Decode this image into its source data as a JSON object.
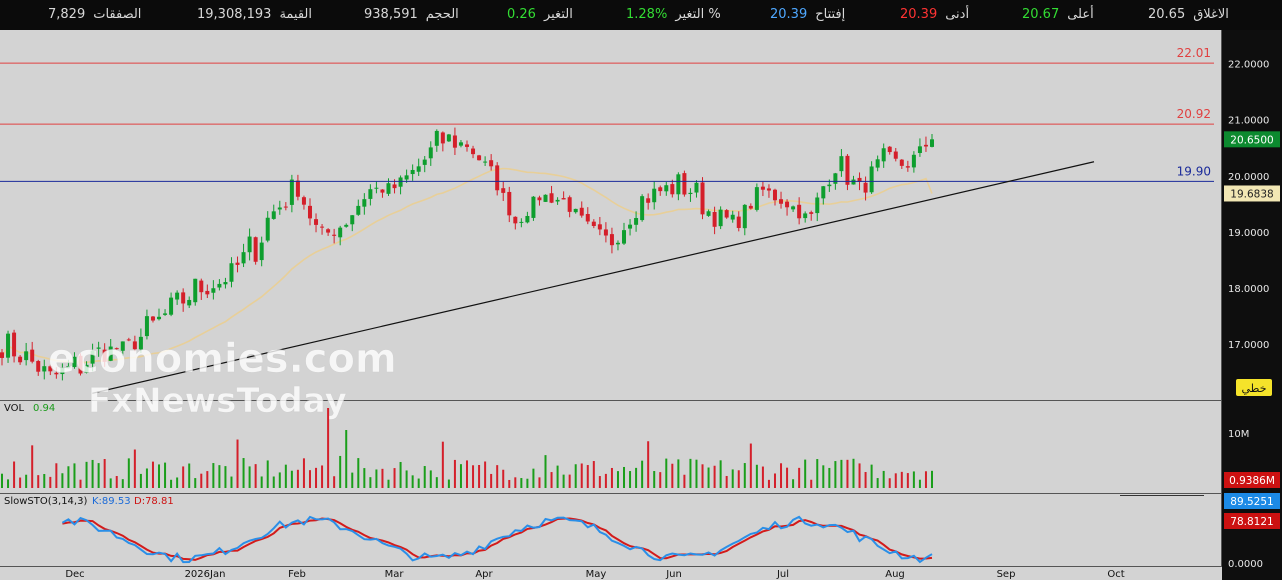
{
  "stats": [
    {
      "label": "الاغلاق",
      "value": "20.65",
      "color": "#d8d8d8"
    },
    {
      "label": "أعلى",
      "value": "20.67",
      "color": "#33dd33"
    },
    {
      "label": "أدنى",
      "value": "20.39",
      "color": "#ff3333"
    },
    {
      "label": "إفتتاح",
      "value": "20.39",
      "color": "#4fa8ff"
    },
    {
      "label": "التغير %",
      "value": "1.28%",
      "color": "#33dd33"
    },
    {
      "label": "التغير",
      "value": "0.26",
      "color": "#33dd33"
    },
    {
      "label": "الحجم",
      "value": "938,591",
      "color": "#d8d8d8"
    },
    {
      "label": "القيمة",
      "value": "19,308,193",
      "color": "#d8d8d8"
    },
    {
      "label": "الصفقات",
      "value": "7,829",
      "color": "#d8d8d8"
    }
  ],
  "watermark": {
    "line1": "economies.com",
    "line2": "FxNewsToday"
  },
  "chart_data": {
    "type": "candlestick",
    "y_axis": {
      "min": 16.0,
      "max": 22.6,
      "ticks": [
        "22.0000",
        "21.0000",
        "20.0000",
        "19.0000",
        "18.0000",
        "17.0000"
      ]
    },
    "x_axis": {
      "labels": [
        "Dec",
        "2026Jan",
        "Feb",
        "Mar",
        "Apr",
        "May",
        "Jun",
        "Jul",
        "Aug",
        "Sep",
        "Oct"
      ]
    },
    "level_lines": [
      {
        "value": 22.01,
        "label": "22.01",
        "color": "#e04040"
      },
      {
        "value": 20.92,
        "label": "20.92",
        "color": "#e04040"
      },
      {
        "value": 19.9,
        "label": "19.90",
        "color": "#1a2a9a"
      }
    ],
    "trendline": {
      "from": {
        "date": "2025-12-05",
        "value": 16.12
      },
      "to": {
        "date": "2026-09-25",
        "value": 20.25
      }
    },
    "last_price": {
      "label": "20.6500",
      "value": 20.65
    },
    "moving_average": {
      "label": "19.6838",
      "value": 19.6838
    },
    "scale_mode": "خطي",
    "ohlc_anchors": [
      [
        16.75,
        17.3
      ],
      [
        16.5,
        17.0
      ],
      [
        16.2,
        16.6
      ],
      [
        16.25,
        16.9
      ],
      [
        16.6,
        17.1
      ],
      [
        16.9,
        17.0
      ],
      [
        16.8,
        17.6
      ],
      [
        17.4,
        17.9
      ],
      [
        17.7,
        18.3
      ],
      [
        18.0,
        18.2
      ],
      [
        18.2,
        18.9
      ],
      [
        18.8,
        19.8
      ],
      [
        19.7,
        20.0
      ],
      [
        18.7,
        19.1
      ],
      [
        19.0,
        19.3
      ],
      [
        19.6,
        19.9
      ],
      [
        19.7,
        19.85
      ],
      [
        20.0,
        20.3
      ],
      [
        20.3,
        21.0
      ],
      [
        20.5,
        20.6
      ],
      [
        19.9,
        20.2
      ],
      [
        19.1,
        19.2
      ],
      [
        19.6,
        19.7
      ],
      [
        19.5,
        19.6
      ],
      [
        18.8,
        19.2
      ],
      [
        18.7,
        18.9
      ],
      [
        19.3,
        19.8
      ],
      [
        19.6,
        19.9
      ],
      [
        19.5,
        20.2
      ],
      [
        19.1,
        19.5
      ],
      [
        19.0,
        19.3
      ],
      [
        19.6,
        19.9
      ],
      [
        19.4,
        19.7
      ],
      [
        19.1,
        19.3
      ],
      [
        20.0,
        20.6
      ],
      [
        19.6,
        19.9
      ],
      [
        19.9,
        20.5
      ],
      [
        20.1,
        20.3
      ],
      [
        20.65,
        20.67
      ]
    ]
  },
  "volume": {
    "label": "VOL",
    "value": "0.94",
    "tick": "10M",
    "last": "0.9386M"
  },
  "stochastic": {
    "title": "SlowSTO(3,14,3)",
    "k_label": "K:89.53",
    "d_label": "D:78.81",
    "k_value": "89.5251",
    "d_value": "78.8121",
    "zero_tick": "0.0000"
  }
}
